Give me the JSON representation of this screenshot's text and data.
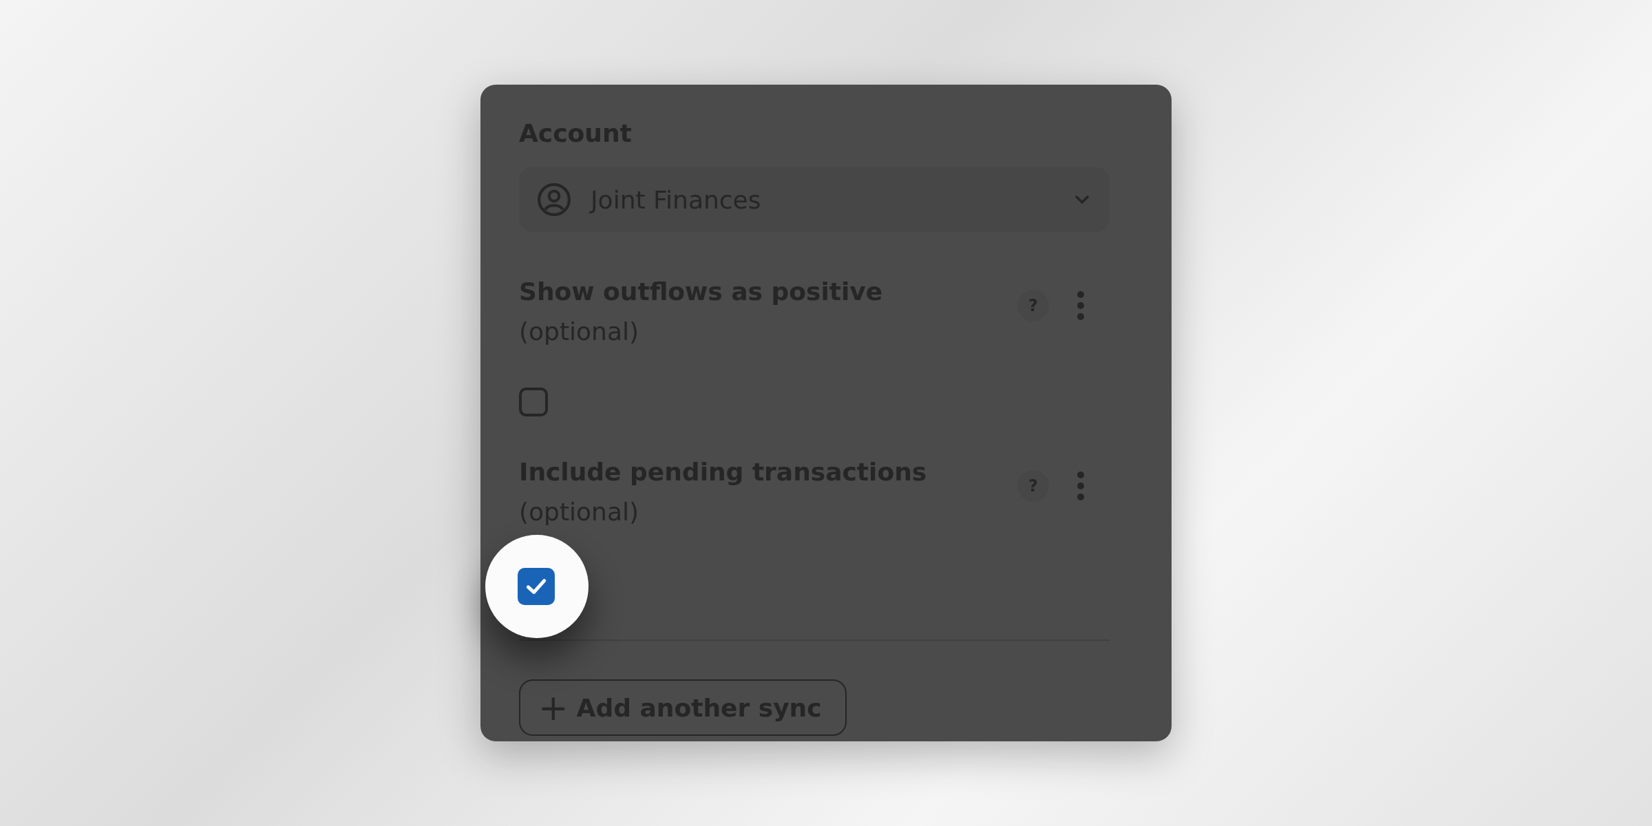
{
  "account": {
    "label": "Account",
    "value": "Joint Finances"
  },
  "options": [
    {
      "label": "Show outflows as positive",
      "hint": "(optional)",
      "help": "?",
      "checked": false
    },
    {
      "label": "Include pending transactions",
      "hint": "(optional)",
      "help": "?",
      "checked": true
    }
  ],
  "add_button": {
    "icon": "+",
    "label": "Add another sync"
  }
}
